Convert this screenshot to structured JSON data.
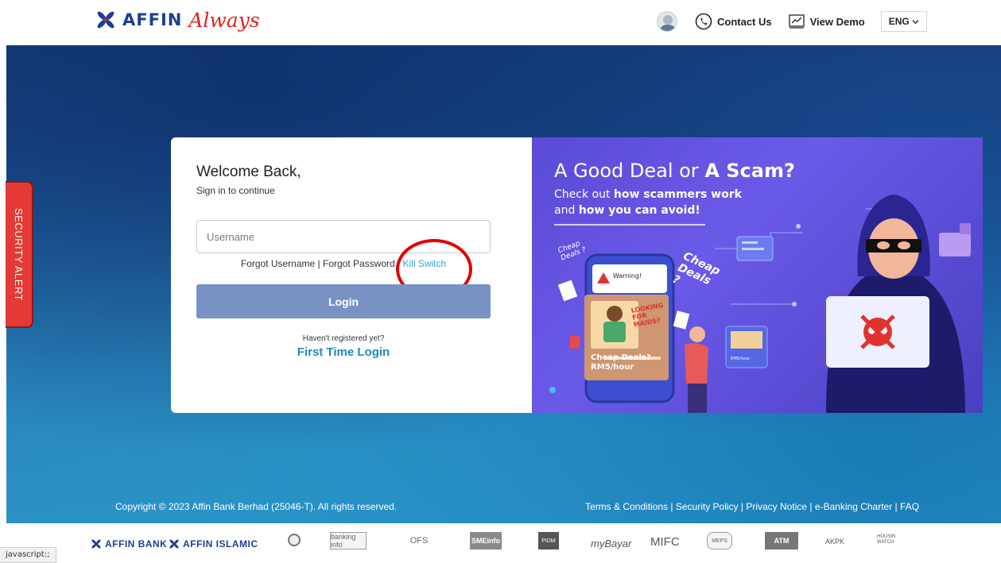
{
  "header": {
    "brand": "AFFIN",
    "brand_script": "Always",
    "contact": "Contact Us",
    "demo": "View Demo",
    "lang": "ENG"
  },
  "security_alert": "SECURITY ALERT",
  "login": {
    "welcome": "Welcome Back,",
    "signin": "Sign in to continue",
    "username_placeholder": "Username",
    "forgot_username": "Forgot Username",
    "sep1": " | ",
    "forgot_password": "Forgot Password",
    "sep2": " | ",
    "kill_switch": "Kill Switch",
    "login_btn": "Login",
    "not_registered": "Haven't registered yet?",
    "first_time": "First Time Login"
  },
  "promo": {
    "title_a": "A Good Deal or ",
    "title_b": "A Scam?",
    "sub1_a": "Check out ",
    "sub1_b": "how scammers work",
    "sub2_a": "and ",
    "sub2_b": "how you can avoid!",
    "cheap1": "Cheap Deals ?",
    "cheap2": "Cheap Deals ?",
    "warning": "Warning!",
    "maid": "LOOKING FOR MAIDS?",
    "cheap_deals": "Cheap Deals?",
    "rate": "RM5/hour",
    "rate_small": "RM5/hour"
  },
  "footer": {
    "copyright": "Copyright © 2023 Affin Bank Berhad (25046-T). All rights reserved.",
    "links": [
      "Terms & Conditions",
      "Security Policy",
      "Privacy Notice",
      "e-Banking Charter",
      "FAQ"
    ]
  },
  "partners": {
    "affin_bank": "AFFIN BANK",
    "affin_islamic": "AFFIN ISLAMIC",
    "bankinginfo": "banking info",
    "ofs": "OFS",
    "smeinfo": "SMEinfo",
    "pidm": "PIDM",
    "mybayar": "myBayar",
    "mifc": "MIFC",
    "meps": "MEPS",
    "atm": "ATM",
    "akpk": "AKPK",
    "housing": "HOUSIN WATCH"
  },
  "status_bar": "javascript:;",
  "colors": {
    "brand_blue": "#1c3f94",
    "brand_red": "#e2231a",
    "login_button": "#7992c4",
    "link_blue": "#1f86c4",
    "alert_red": "#e53935",
    "promo_purple": "#5a4bd6"
  }
}
